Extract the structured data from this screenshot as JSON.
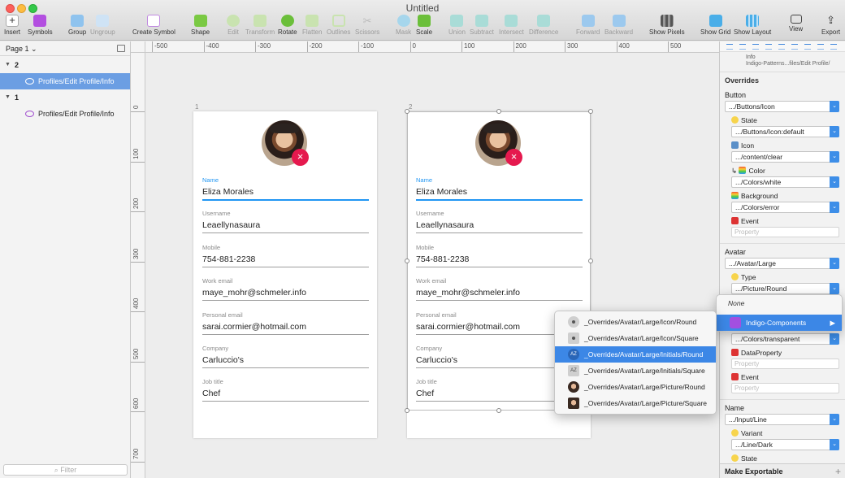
{
  "window": {
    "title": "Untitled"
  },
  "toolbar": {
    "insert": "Insert",
    "symbols": "Symbols",
    "group": "Group",
    "ungroup": "Ungroup",
    "create_symbol": "Create Symbol",
    "shape": "Shape",
    "edit": "Edit",
    "transform": "Transform",
    "rotate": "Rotate",
    "flatten": "Flatten",
    "outlines": "Outlines",
    "scissors": "Scissors",
    "mask": "Mask",
    "scale": "Scale",
    "union": "Union",
    "subtract": "Subtract",
    "intersect": "Intersect",
    "difference": "Difference",
    "forward": "Forward",
    "backward": "Backward",
    "show_pixels": "Show Pixels",
    "show_grid": "Show Grid",
    "show_layout": "Show Layout",
    "view": "View",
    "export": "Export"
  },
  "sidebar": {
    "page": "Page 1",
    "layers": [
      {
        "name": "2",
        "type": "artboard"
      },
      {
        "name": "Profiles/Edit Profile/Info",
        "type": "symbol",
        "selected": true
      },
      {
        "name": "1",
        "type": "artboard"
      },
      {
        "name": "Profiles/Edit Profile/Info",
        "type": "symbol",
        "selected": false
      }
    ],
    "filter_placeholder": "Filter"
  },
  "ruler": {
    "top": [
      "-500",
      "-400",
      "-300",
      "-200",
      "-100",
      "0",
      "100",
      "200",
      "300",
      "400",
      "500",
      "600"
    ],
    "left": [
      "0",
      "100",
      "200",
      "300",
      "400",
      "500",
      "600",
      "700"
    ]
  },
  "artboards": [
    {
      "number": "1",
      "fields": [
        {
          "label": "Name",
          "value": "Eliza Morales",
          "active": true
        },
        {
          "label": "Username",
          "value": "Leaellynasaura"
        },
        {
          "label": "Mobile",
          "value": "754-881-2238"
        },
        {
          "label": "Work email",
          "value": "maye_mohr@schmeler.info"
        },
        {
          "label": "Personal email",
          "value": "sarai.cormier@hotmail.com"
        },
        {
          "label": "Company",
          "value": "Carluccio's"
        },
        {
          "label": "Job title",
          "value": "Chef"
        }
      ]
    },
    {
      "number": "2",
      "fields": [
        {
          "label": "Name",
          "value": "Eliza Morales",
          "active": true
        },
        {
          "label": "Username",
          "value": "Leaellynasaura"
        },
        {
          "label": "Mobile",
          "value": "754-881-2238"
        },
        {
          "label": "Work email",
          "value": "maye_mohr@schmeler.info"
        },
        {
          "label": "Personal email",
          "value": "sarai.cormier@hotmail.com"
        },
        {
          "label": "Company",
          "value": "Carluccio's"
        },
        {
          "label": "Job title",
          "value": "Chef"
        }
      ]
    }
  ],
  "inspector": {
    "symbol_name": "Info",
    "symbol_path": "Indigo-Patterns...files/Edit Profile/",
    "overrides_title": "Overrides",
    "button_section": "Button",
    "button_value": ".../Buttons/Icon",
    "state_label": "State",
    "state_value": ".../Buttons/Icon:default",
    "icon_label": "Icon",
    "icon_value": ".../content/clear",
    "color_label": "Color",
    "color_value": ".../Colors/white",
    "background_label": "Background",
    "background_value": ".../Colors/error",
    "event_label": "Event",
    "property_placeholder": "Property",
    "avatar_section": "Avatar",
    "avatar_value": ".../Avatar/Large",
    "type_label": "Type",
    "type_value": ".../Picture/Round",
    "bg2_value": ".../Colors/transparent",
    "dataproperty_label": "DataProperty",
    "event2_label": "Event",
    "name_section": "Name",
    "name_value": ".../Input/Line",
    "variant_label": "Variant",
    "variant_value": ".../Line/Dark",
    "state2_label": "State",
    "make_exportable": "Make Exportable"
  },
  "menu": {
    "none": "None",
    "library": "Indigo-Components",
    "items": [
      {
        "label": "_Overrides/Avatar/Large/Icon/Round",
        "thumb": ""
      },
      {
        "label": "_Overrides/Avatar/Large/Icon/Square",
        "thumb": ""
      },
      {
        "label": "_Overrides/Avatar/Large/Initials/Round",
        "thumb": "AZ",
        "highlighted": true
      },
      {
        "label": "_Overrides/Avatar/Large/Initials/Square",
        "thumb": "AZ"
      },
      {
        "label": "_Overrides/Avatar/Large/Picture/Round",
        "thumb": ""
      },
      {
        "label": "_Overrides/Avatar/Large/Picture/Square",
        "thumb": ""
      }
    ]
  },
  "colors": {
    "accent": "#3c87e6",
    "error": "#e5194e",
    "field_active": "#2196f3",
    "symbol": "#a14fcf"
  }
}
